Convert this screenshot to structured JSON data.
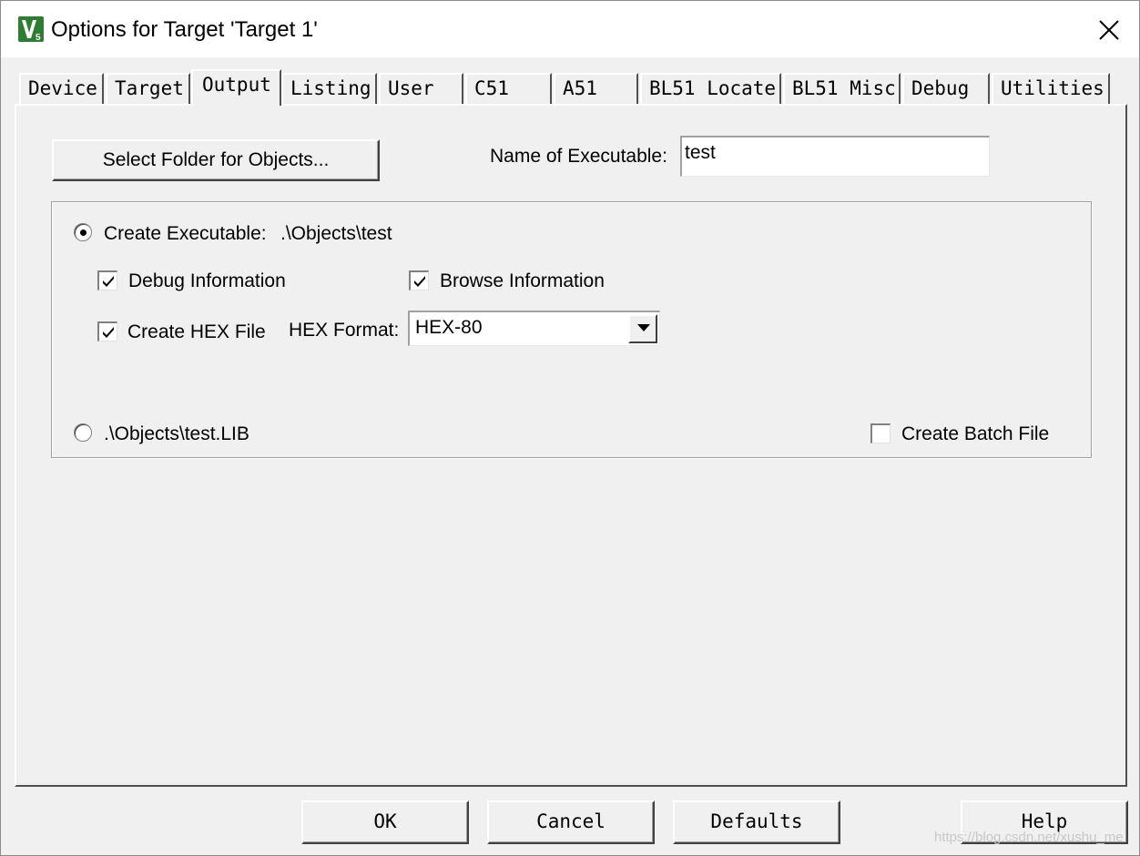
{
  "window": {
    "title": "Options for Target 'Target 1'",
    "icon": "keil-uvision-icon",
    "close_glyph": "✕"
  },
  "tabs": [
    {
      "label": "Device"
    },
    {
      "label": "Target"
    },
    {
      "label": "Output",
      "active": true
    },
    {
      "label": "Listing"
    },
    {
      "label": "User"
    },
    {
      "label": "C51"
    },
    {
      "label": "A51"
    },
    {
      "label": "BL51 Locate"
    },
    {
      "label": "BL51 Misc"
    },
    {
      "label": "Debug"
    },
    {
      "label": "Utilities"
    }
  ],
  "output": {
    "select_folder_label": "Select Folder for Objects...",
    "name_of_executable_label": "Name of Executable:",
    "name_of_executable_value": "test",
    "create_executable_label": "Create Executable:",
    "create_executable_path": ".\\Objects\\test",
    "create_executable_selected": true,
    "debug_information_label": "Debug Information",
    "debug_information_checked": true,
    "browse_information_label": "Browse Information",
    "browse_information_checked": true,
    "create_hex_label": "Create HEX File",
    "create_hex_checked": true,
    "hex_format_label": "HEX Format:",
    "hex_format_value": "HEX-80",
    "library_path": ".\\Objects\\test.LIB",
    "library_selected": false,
    "create_batch_label": "Create Batch File",
    "create_batch_checked": false
  },
  "footer": {
    "ok_label": "OK",
    "cancel_label": "Cancel",
    "defaults_label": "Defaults",
    "help_label": "Help"
  },
  "watermark": "https://blog.csdn.net/xushu_me"
}
